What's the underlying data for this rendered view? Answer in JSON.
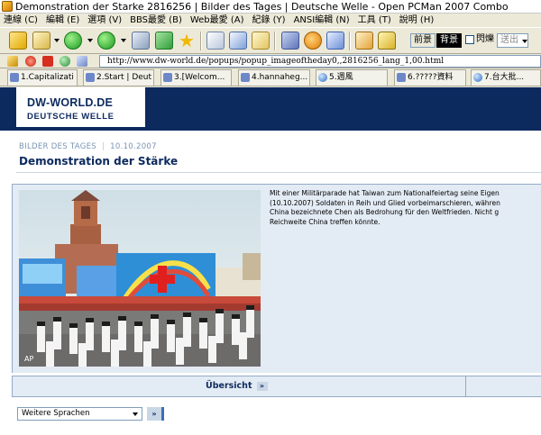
{
  "window": {
    "title": "Demonstration der Starke 2816256 | Bilder des Tages | Deutsche Welle - Open PCMan 2007 Combo"
  },
  "menu": [
    "連線 (C)",
    "編輯 (E)",
    "選項 (V)",
    "BBS最愛 (B)",
    "Web最愛 (A)",
    "紀錄 (Y)",
    "ANSI編輯 (N)",
    "工具 (T)",
    "說明 (H)"
  ],
  "toolbar": {
    "fg_label": "前景",
    "bg_label": "背景",
    "blink_label": "閃爍",
    "send_label": "送出"
  },
  "address": {
    "url": "http://www.dw-world.de/popups/popup_imageoftheday0,,2816256_lang_1,00.html"
  },
  "tabs": [
    {
      "label": "1.Capitalizati"
    },
    {
      "label": "2.Start | Deut"
    },
    {
      "label": "3.[Welcom..."
    },
    {
      "label": "4.hannaheg..."
    },
    {
      "label": "5.週風"
    },
    {
      "label": "6.?????資料"
    },
    {
      "label": "7.台大批..."
    }
  ],
  "site": {
    "logo_line1": "DW-WORLD.DE",
    "logo_line2": "DEUTSCHE WELLE"
  },
  "article": {
    "section": "BILDER DES TAGES",
    "date": "10.10.2007",
    "title": "Demonstration der Stärke",
    "caption": "Mit einer Militärparade hat Taiwan zum Nationalfeiertag seine Eigen\n(10.10.2007) Soldaten in Reih und Glied vorbeimarschieren, währen\nChina bezeichnete Chen als Bedrohung für den Weltfrieden. Nicht g\nReichweite China treffen könnte.",
    "photo_credit": "AP"
  },
  "nav": {
    "overview_label": "Übersicht",
    "arrow": "»"
  },
  "language": {
    "selected": "Weitere Sprachen",
    "go_label": "»"
  }
}
